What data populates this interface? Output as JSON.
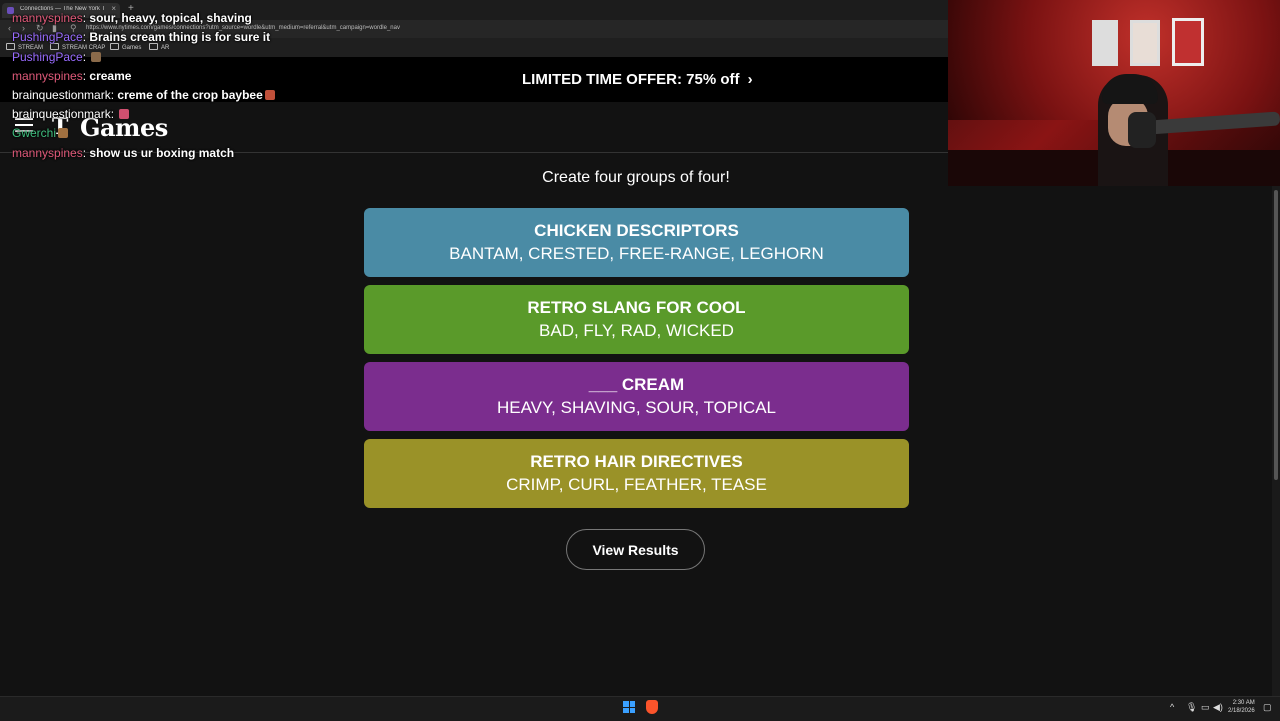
{
  "browser": {
    "tab_title": "Connections — The New York Times",
    "tab_close": "×",
    "new_tab": "+",
    "url": "https://www.nytimes.com/games/connections?utm_source=wordle&utm_medium=referral&utm_campaign=wordle_nav",
    "bookmarks": [
      "STREAM",
      "STREAM CRAP",
      "Games",
      "AR"
    ]
  },
  "offer": {
    "text": "LIMITED TIME OFFER:  75% off",
    "chevron": "›"
  },
  "header": {
    "logo_mark": "T",
    "logo_text": "Games"
  },
  "puzzle": {
    "subtitle": "Create four groups of four!",
    "groups": [
      {
        "title": "CHICKEN DESCRIPTORS",
        "words": "BANTAM, CRESTED, FREE-RANGE, LEGHORN",
        "color": "#4a8ba5"
      },
      {
        "title": "RETRO SLANG FOR COOL",
        "words": "BAD, FLY, RAD, WICKED",
        "color": "#5a9a2a"
      },
      {
        "title": "___ CREAM",
        "words": "HEAVY, SHAVING, SOUR, TOPICAL",
        "color": "#7b2d8e"
      },
      {
        "title": "RETRO HAIR DIRECTIVES",
        "words": "CRIMP, CURL, FEATHER, TEASE",
        "color": "#9a9228"
      }
    ],
    "view_results_label": "View Results"
  },
  "chat": [
    {
      "user": "mannyspines",
      "user_color": "#e05a7a",
      "sep": ": ",
      "msg": "sour, heavy, topical, shaving"
    },
    {
      "user": "PushingPace",
      "user_color": "#9a6cff",
      "sep": ": ",
      "msg": "Brains cream thing is for sure it"
    },
    {
      "user": "PushingPace",
      "user_color": "#9a6cff",
      "sep": ": ",
      "msg": ""
    },
    {
      "user": "mannyspines",
      "user_color": "#e05a7a",
      "sep": ": ",
      "msg": "creame"
    },
    {
      "user": "brainquestionmark",
      "user_color": "#ffffff",
      "sep": ": ",
      "msg": "creme of the crop baybee"
    },
    {
      "user": "brainquestionmark",
      "user_color": "#ffffff",
      "sep": ": ",
      "msg": ""
    },
    {
      "user": "Gwerchi",
      "user_color": "#3fbf7f",
      "sep": "",
      "msg": ""
    },
    {
      "user": "mannyspines",
      "user_color": "#e05a7a",
      "sep": ": ",
      "msg": "show us ur boxing match"
    }
  ],
  "taskbar": {
    "time": "2:30 AM",
    "date": "2/18/2026"
  }
}
